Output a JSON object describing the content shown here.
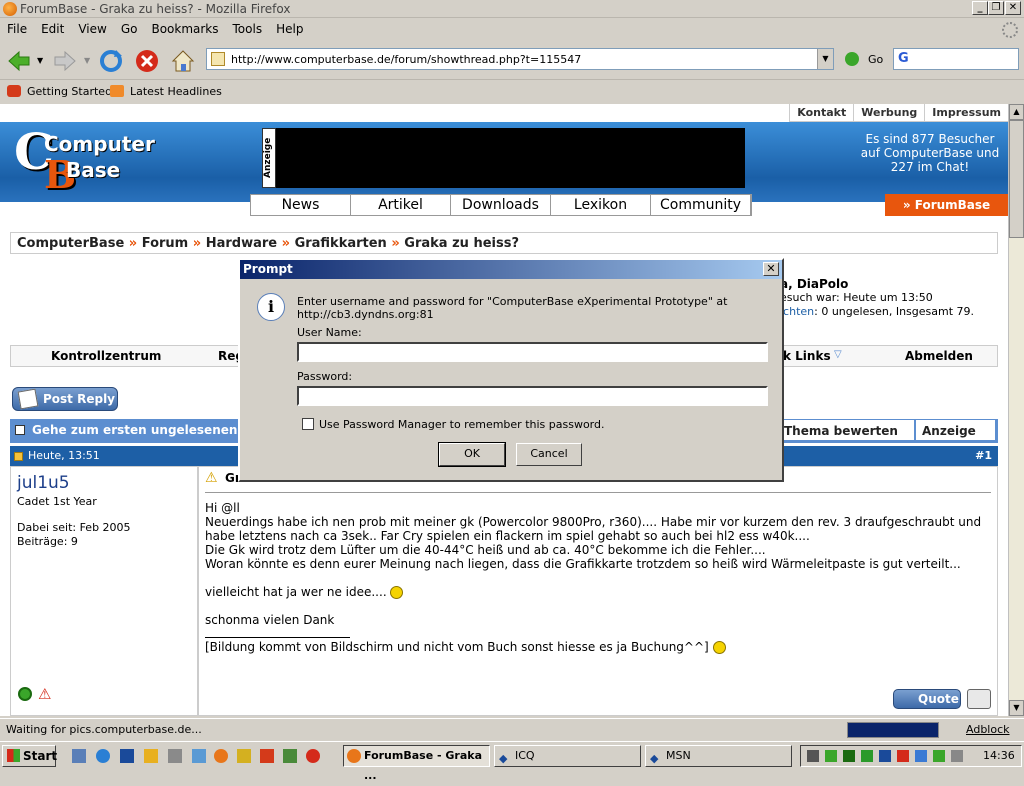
{
  "window": {
    "title": "ForumBase - Graka zu heiss? - Mozilla Firefox"
  },
  "menu": [
    "File",
    "Edit",
    "View",
    "Go",
    "Bookmarks",
    "Tools",
    "Help"
  ],
  "nav": {
    "url": "http://www.computerbase.de/forum/showthread.php?t=115547",
    "go_label": "Go",
    "search_placeholder": "G"
  },
  "bookmarks": [
    "Getting Started",
    "Latest Headlines"
  ],
  "site": {
    "toplinks": [
      "Kontakt",
      "Werbung",
      "Impressum"
    ],
    "logo_line1": "Computer",
    "logo_line2": "Base",
    "ad_label": "Anzeige",
    "visitors": "Es sind 877 Besucher auf ComputerBase und 227 im Chat!",
    "tabs": [
      "News",
      "Artikel",
      "Downloads",
      "Lexikon",
      "Community"
    ],
    "forumbase_tab": "» ForumBase",
    "breadcrumb": [
      "ComputerBase",
      "Forum",
      "Hardware",
      "Grafikkarten",
      "Graka zu heiss?"
    ],
    "breadcrumb_sep": "»",
    "user_line1": "a, DiaPolo",
    "user_line2": "esuch war: Heute um 13:50",
    "user_line3_link": "ichten",
    "user_line3_rest": ": 0 ungelesen, Insgesamt 79.",
    "ctrl_left": "Kontrollzentrum",
    "ctrl_reg": "Reg",
    "ctrl_links": "k Links",
    "ctrl_logout": "Abmelden",
    "post_reply": "Post Reply",
    "unread": "Gehe zum ersten ungelesenen B",
    "thema_bewerten": "Thema bewerten",
    "anzeige": "Anzeige"
  },
  "post": {
    "time": "Heute, 13:51",
    "number": "#1",
    "author": "jul1u5",
    "rank": "Cadet 1st Year",
    "joined": "Dabei seit: Feb 2005",
    "posts": "Beiträge: 9",
    "title": "Graka zu heiss?",
    "greeting": "Hi @ll",
    "line1": "Neuerdings habe ich nen prob mit meiner gk (Powercolor 9800Pro, r360).... Habe mir vor kurzem den rev. 3 draufgeschraubt und habe letztens nach ca 3sek.. Far Cry spielen ein flackern im spiel gehabt so auch bei hl2 ess w40k....",
    "line2": "Die Gk wird trotz dem Lüfter um die 40-44°C heiß und ab ca. 40°C bekomme ich die Fehler....",
    "line3": "Woran könnte es denn eurer Meinung nach liegen, dass die Grafikkarte trotzdem so heiß wird Wärmeleitpaste is gut verteilt...",
    "line4": "vielleicht hat ja wer ne idee....",
    "line5": "schonma vielen Dank",
    "signature": "[Bildung kommt von Bildschirm und nicht vom Buch sonst hiesse es ja Buchung^^]",
    "quote_label": "Quote"
  },
  "dialog": {
    "title": "Prompt",
    "message1": "Enter username and password for \"ComputerBase eXperimental Prototype\" at",
    "message2": "http://cb3.dyndns.org:81",
    "username_label": "User Name:",
    "username_value": "",
    "password_label": "Password:",
    "password_value": "",
    "remember_label": "Use Password Manager to remember this password.",
    "ok": "OK",
    "cancel": "Cancel"
  },
  "status": {
    "text": "Waiting for pics.computerbase.de...",
    "adblock": "Adblock"
  },
  "taskbar": {
    "start": "Start",
    "tasks": [
      "ForumBase - Graka ...",
      "ICQ",
      "MSN"
    ],
    "clock": "14:36"
  }
}
